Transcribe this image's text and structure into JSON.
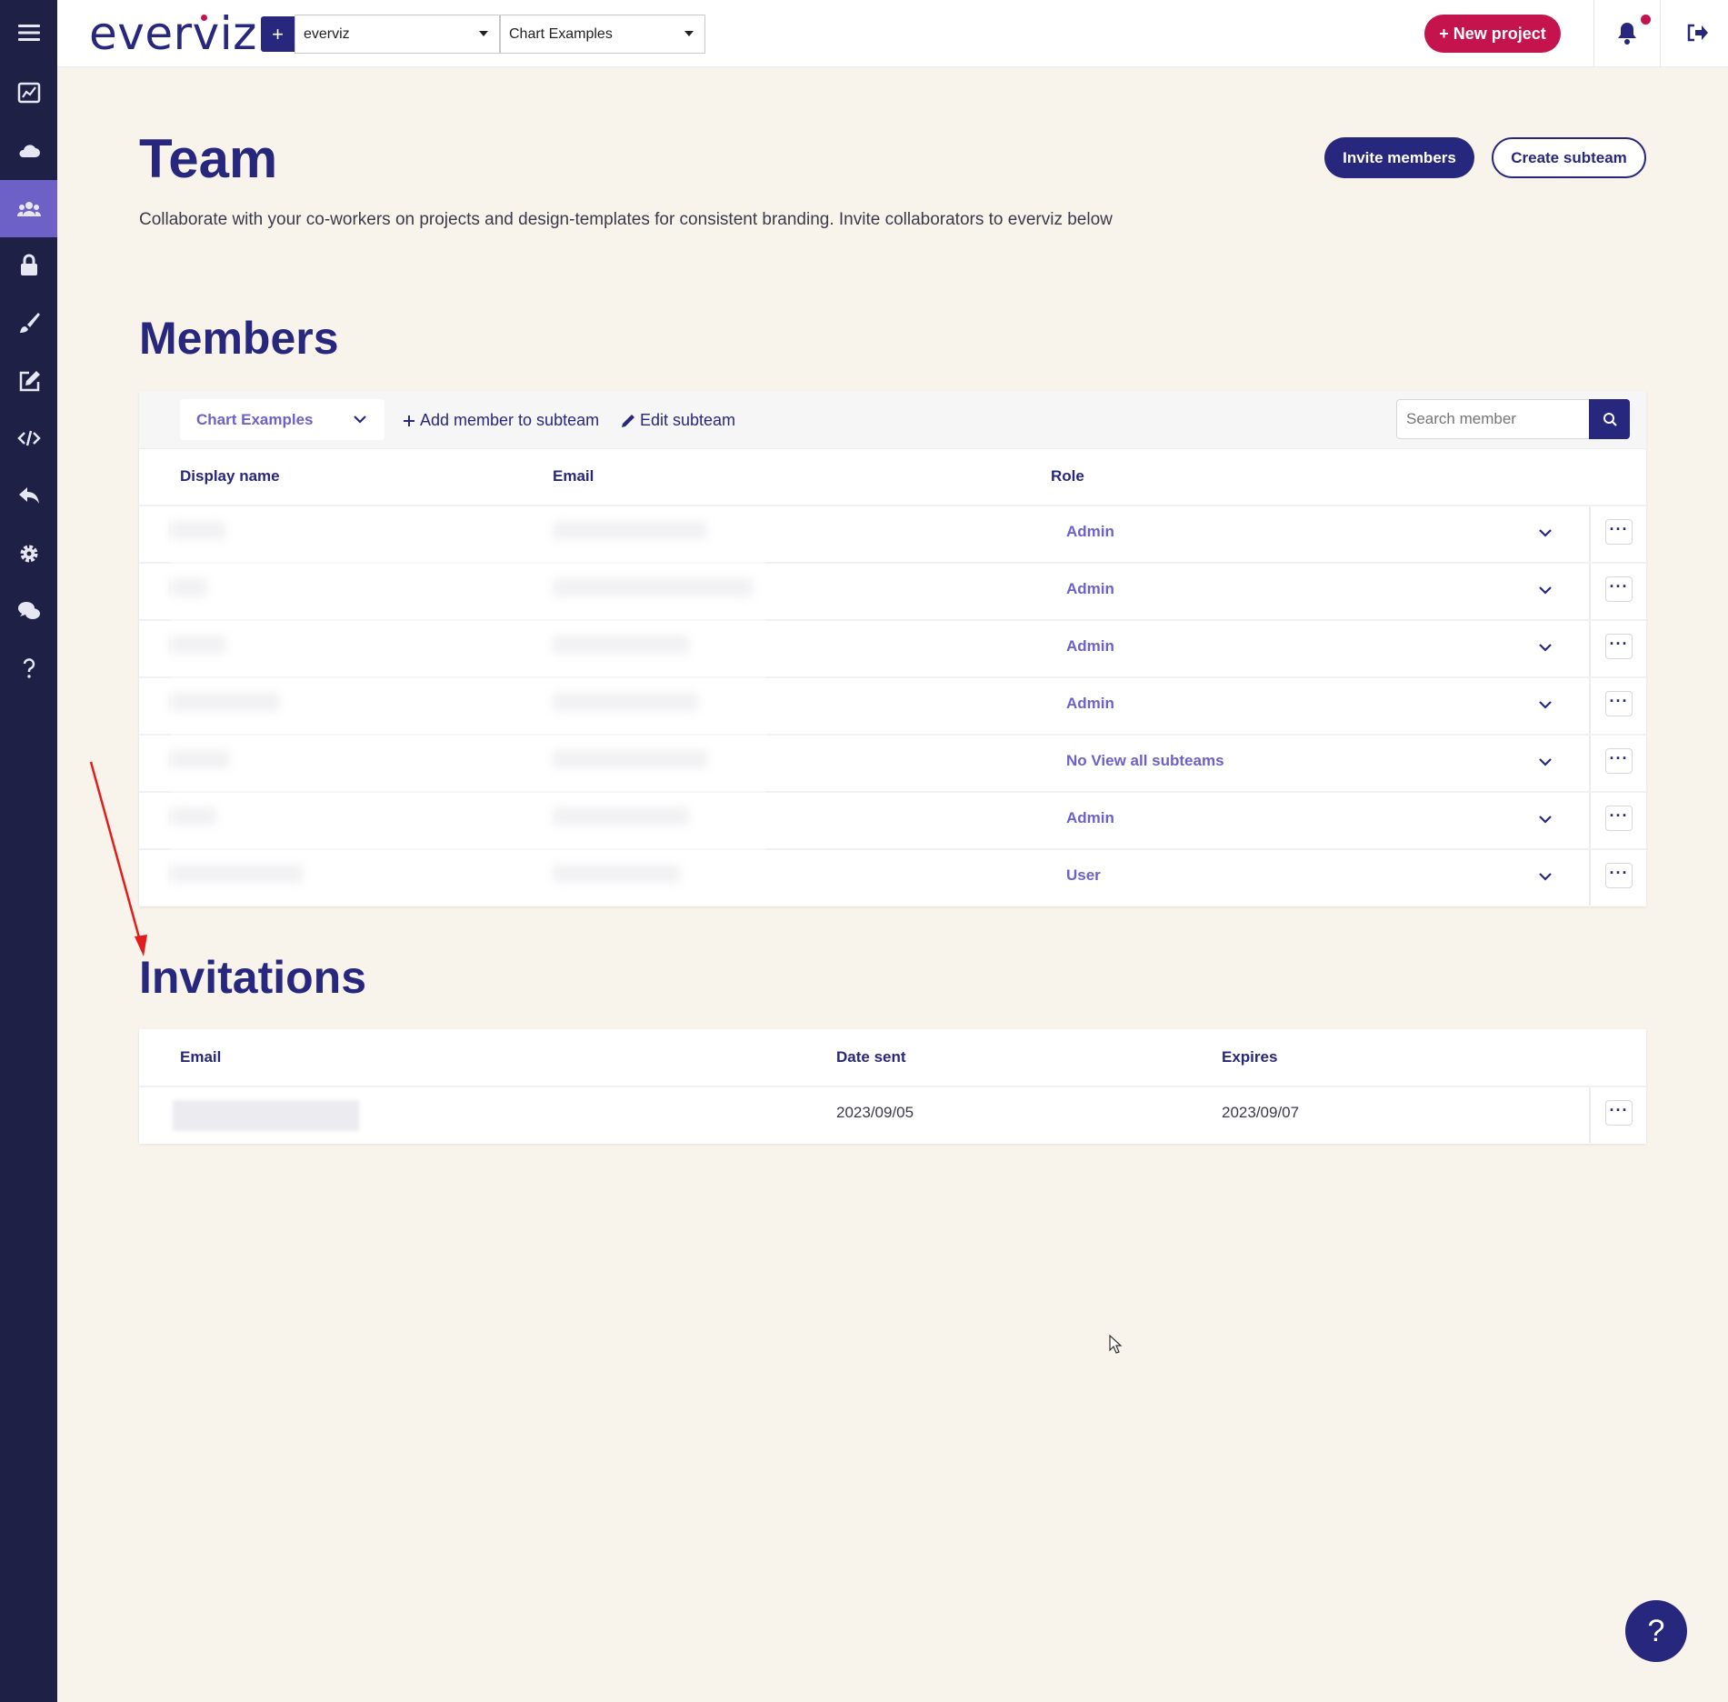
{
  "app": {
    "logo": "everviz",
    "team_select": "everviz",
    "project_select": "Chart Examples",
    "new_project_label": "+ New project",
    "add_label": "+"
  },
  "colors": {
    "primary": "#28277e",
    "accent": "#6d61c8",
    "brand_red": "#c5134d",
    "sidebar_bg": "#1f2046",
    "page_bg": "#f8f4ec"
  },
  "sidebar": {
    "items": [
      {
        "icon": "menu-icon"
      },
      {
        "icon": "charts-icon"
      },
      {
        "icon": "cloud-icon"
      },
      {
        "icon": "team-icon",
        "active": true
      },
      {
        "icon": "lock-icon"
      },
      {
        "icon": "brush-icon"
      },
      {
        "icon": "edit-icon"
      },
      {
        "icon": "code-icon"
      },
      {
        "icon": "reply-icon"
      },
      {
        "icon": "gear-icon"
      },
      {
        "icon": "chat-icon"
      },
      {
        "icon": "help-icon"
      }
    ]
  },
  "header": {
    "title": "Team",
    "description": "Collaborate with your co-workers on projects and design-templates for consistent branding. Invite collaborators to everviz below",
    "invite_label": "Invite members",
    "create_subteam_label": "Create subteam"
  },
  "members": {
    "title": "Members",
    "subteam": "Chart Examples",
    "add_member_label": "Add member to subteam",
    "edit_subteam_label": "Edit subteam",
    "search_placeholder": "Search member",
    "columns": {
      "name": "Display name",
      "email": "Email",
      "role": "Role"
    },
    "rows": [
      {
        "role": "Admin"
      },
      {
        "role": "Admin"
      },
      {
        "role": "Admin"
      },
      {
        "role": "Admin"
      },
      {
        "role": "No View all subteams"
      },
      {
        "role": "Admin"
      },
      {
        "role": "User"
      }
    ]
  },
  "invitations": {
    "title": "Invitations",
    "columns": {
      "email": "Email",
      "date_sent": "Date sent",
      "expires": "Expires"
    },
    "rows": [
      {
        "date_sent": "2023/09/05",
        "expires": "2023/09/07"
      }
    ]
  },
  "help_fab": "?"
}
